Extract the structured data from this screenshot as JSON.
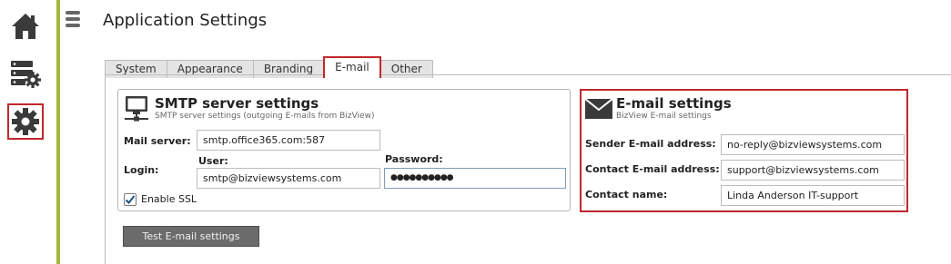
{
  "sidebar": {
    "icons": [
      "home-icon",
      "server-settings-icon",
      "gear-icon"
    ],
    "accent_color": "#a3b73a",
    "highlight_color": "#c1272d"
  },
  "header": {
    "title": "Application Settings"
  },
  "tabs": [
    {
      "label": "System",
      "active": false
    },
    {
      "label": "Appearance",
      "active": false
    },
    {
      "label": "Branding",
      "active": false
    },
    {
      "label": "E-mail",
      "active": true
    },
    {
      "label": "Other",
      "active": false
    }
  ],
  "smtp": {
    "title": "SMTP server settings",
    "subtitle": "SMTP server settings (outgoing E-mails from BizView)",
    "mail_server_label": "Mail server:",
    "mail_server_value": "smtp.office365.com:587",
    "login_label": "Login:",
    "user_label": "User:",
    "user_value": "smtp@bizviewsystems.com",
    "password_label": "Password:",
    "password_value": "●●●●●●●●●●",
    "ssl_label": "Enable SSL",
    "ssl_checked": true
  },
  "email": {
    "title": "E-mail settings",
    "subtitle": "BizView E-mail settings",
    "sender_label": "Sender E-mail address:",
    "sender_value": "no-reply@bizviewsystems.com",
    "contact_label": "Contact E-mail address:",
    "contact_value": "support@bizviewsystems.com",
    "contact_name_label": "Contact name:",
    "contact_name_value": "Linda Anderson IT-support"
  },
  "actions": {
    "test_label": "Test E-mail settings"
  }
}
